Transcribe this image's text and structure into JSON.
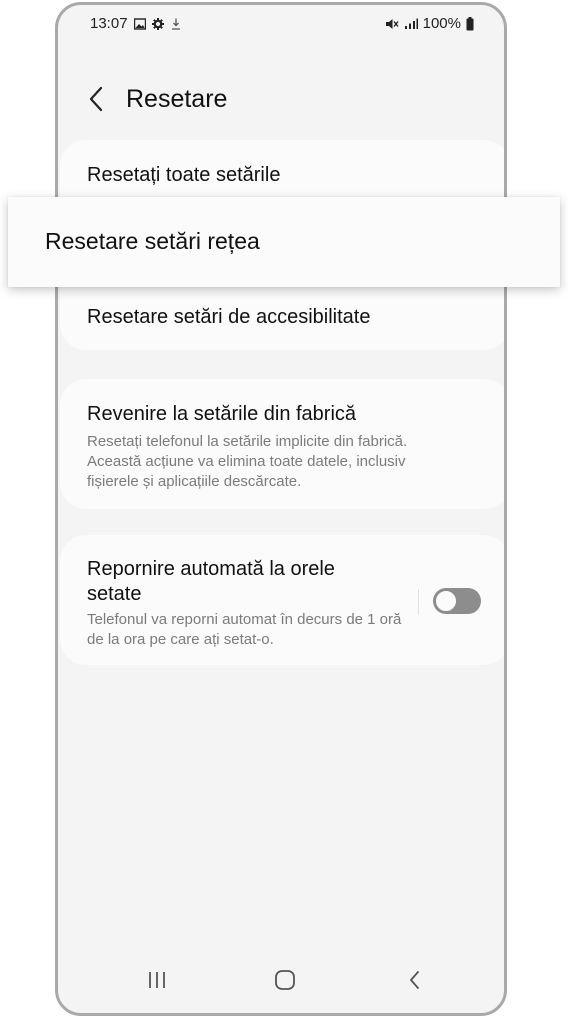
{
  "status_bar": {
    "time": "13:07",
    "battery": "100%",
    "icons_left": [
      "image-icon",
      "gear-icon",
      "download-icon"
    ],
    "icons_right": [
      "mute-icon",
      "signal-icon",
      "battery-icon"
    ]
  },
  "header": {
    "title": "Resetare",
    "back_icon": "chevron-left-icon"
  },
  "items": {
    "reset_all": {
      "label": "Resetați toate setările"
    },
    "reset_network": {
      "label": "Resetare setări rețea"
    },
    "reset_accessibility": {
      "label": "Resetare setări de accesibilitate"
    },
    "factory_reset": {
      "label": "Revenire la setările din fabrică",
      "description": "Resetați telefonul la setările implicite din fabrică. Această acțiune va elimina toate datele, inclusiv fișierele și aplicațiile descărcate."
    },
    "auto_restart": {
      "label": "Repornire automată la orele setate",
      "description": "Telefonul va reporni automat în decurs de 1 oră de la ora pe care ați setat-o.",
      "toggle_on": false
    }
  },
  "navbar": {
    "icons": [
      "recent-apps-icon",
      "home-icon",
      "back-icon"
    ]
  },
  "colors": {
    "screen_background": "#f4f4f4",
    "card_background": "#fbfbfb",
    "toggle_off": "#8d8d8d",
    "phone_frame": "#a9a9a9"
  }
}
